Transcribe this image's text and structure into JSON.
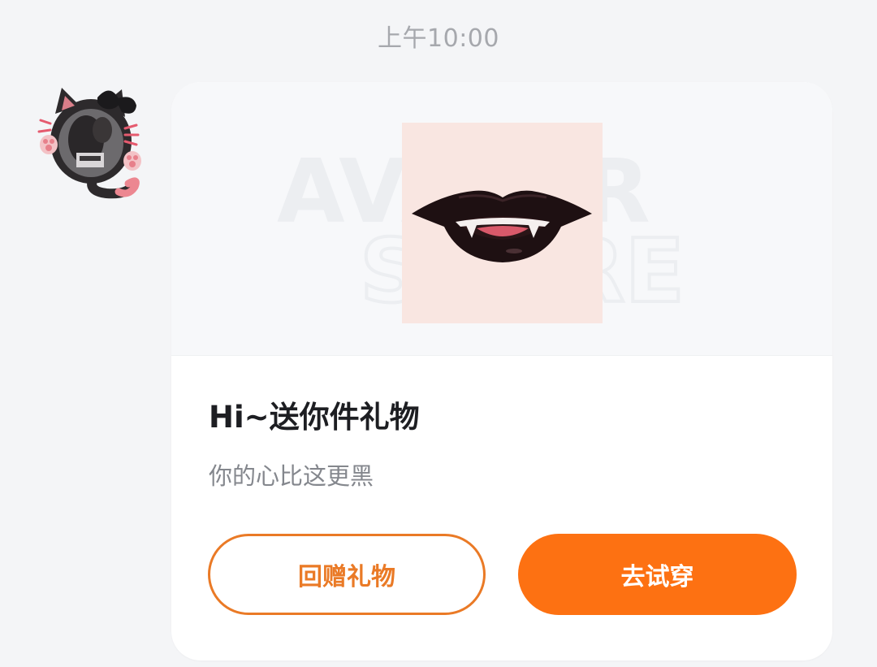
{
  "timestamp": "上午10:00",
  "message": {
    "watermark_text": [
      "AVATAR",
      "STORE"
    ],
    "product": {
      "icon": "vampire-lips-fangs",
      "background_color": "#f9e6e1"
    },
    "title": "Hi~送你件礼物",
    "subtitle": "你的心比这更黑",
    "buttons": {
      "return_gift": "回赠礼物",
      "try_on": "去试穿"
    }
  },
  "colors": {
    "accent": "#fd7112",
    "outline_accent": "#ea7a26",
    "page_background": "#f4f5f7",
    "card_background": "#ffffff"
  }
}
